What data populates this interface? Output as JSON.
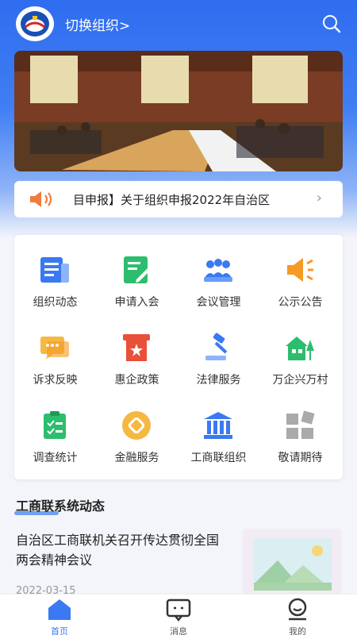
{
  "header": {
    "org_switch": "切换组织>"
  },
  "notice": {
    "text": "目申报】关于组织申报2022年自治区",
    "arrow": "›"
  },
  "grid": [
    {
      "label": "组织动态",
      "icon": "news-icon"
    },
    {
      "label": "申请入会",
      "icon": "apply-icon"
    },
    {
      "label": "会议管理",
      "icon": "meeting-icon"
    },
    {
      "label": "公示公告",
      "icon": "announcement-icon"
    },
    {
      "label": "诉求反映",
      "icon": "chat-icon"
    },
    {
      "label": "惠企政策",
      "icon": "policy-icon"
    },
    {
      "label": "法律服务",
      "icon": "gavel-icon"
    },
    {
      "label": "万企兴万村",
      "icon": "village-icon"
    },
    {
      "label": "调查统计",
      "icon": "survey-icon"
    },
    {
      "label": "金融服务",
      "icon": "finance-icon"
    },
    {
      "label": "工商联组织",
      "icon": "institution-icon"
    },
    {
      "label": "敬请期待",
      "icon": "more-icon"
    }
  ],
  "section": {
    "title": "工商联系统动态"
  },
  "news": {
    "title": "自治区工商联机关召开传达贯彻全国两会精神会议",
    "date": "2022-03-15"
  },
  "tabs": [
    {
      "label": "首页",
      "icon": "home-icon",
      "active": true
    },
    {
      "label": "消息",
      "icon": "message-icon",
      "active": false
    },
    {
      "label": "我的",
      "icon": "profile-icon",
      "active": false
    }
  ],
  "colors": {
    "primary": "#3a79f2",
    "orange": "#f59a23",
    "green": "#2dbd6e",
    "red": "#e8503a"
  }
}
